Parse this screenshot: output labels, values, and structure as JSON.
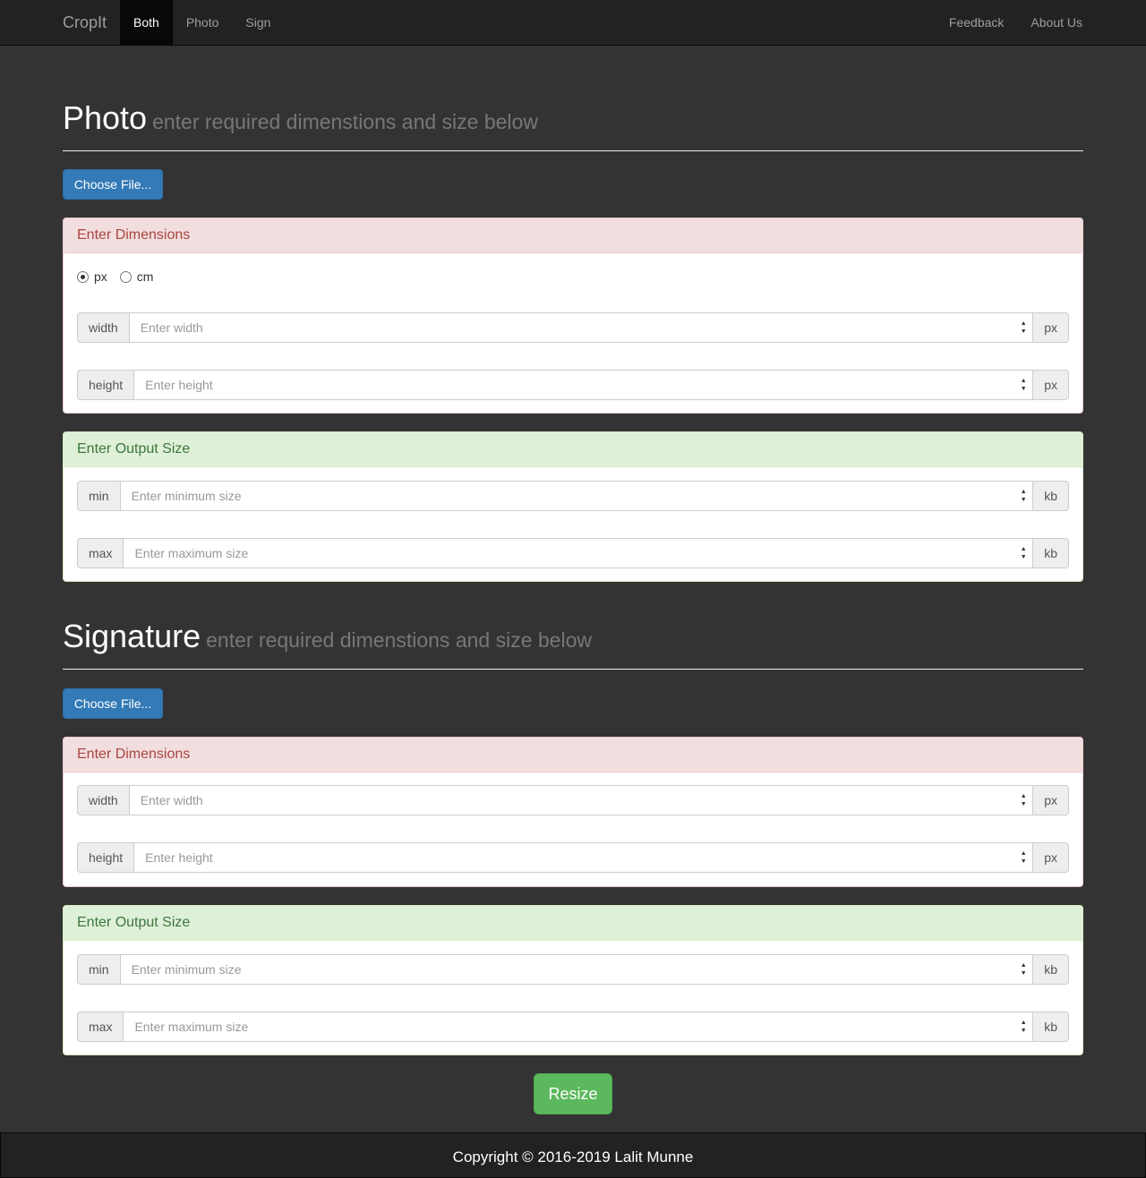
{
  "navbar": {
    "brand": "CropIt",
    "left_items": [
      {
        "label": "Both",
        "active": true
      },
      {
        "label": "Photo",
        "active": false
      },
      {
        "label": "Sign",
        "active": false
      }
    ],
    "right_items": [
      {
        "label": "Feedback"
      },
      {
        "label": "About Us"
      }
    ]
  },
  "photo": {
    "title": "Photo",
    "subtitle": "enter required dimenstions and size below",
    "choose_file_label": "Choose File...",
    "dimensions": {
      "heading": "Enter Dimensions",
      "units": [
        {
          "label": "px",
          "checked": true
        },
        {
          "label": "cm",
          "checked": false
        }
      ],
      "width": {
        "addon": "width",
        "placeholder": "Enter width",
        "unit": "px",
        "value": ""
      },
      "height": {
        "addon": "height",
        "placeholder": "Enter height",
        "unit": "px",
        "value": ""
      }
    },
    "output": {
      "heading": "Enter Output Size",
      "min": {
        "addon": "min",
        "placeholder": "Enter minimum size",
        "unit": "kb",
        "value": ""
      },
      "max": {
        "addon": "max",
        "placeholder": "Enter maximum size",
        "unit": "kb",
        "value": ""
      }
    }
  },
  "signature": {
    "title": "Signature",
    "subtitle": "enter required dimenstions and size below",
    "choose_file_label": "Choose File...",
    "dimensions": {
      "heading": "Enter Dimensions",
      "width": {
        "addon": "width",
        "placeholder": "Enter width",
        "unit": "px",
        "value": ""
      },
      "height": {
        "addon": "height",
        "placeholder": "Enter height",
        "unit": "px",
        "value": ""
      }
    },
    "output": {
      "heading": "Enter Output Size",
      "min": {
        "addon": "min",
        "placeholder": "Enter minimum size",
        "unit": "kb",
        "value": ""
      },
      "max": {
        "addon": "max",
        "placeholder": "Enter maximum size",
        "unit": "kb",
        "value": ""
      }
    }
  },
  "resize_label": "Resize",
  "footer": {
    "text": "Copyright © 2016-2019 Lalit Munne"
  },
  "colors": {
    "navbar_bg": "#222222",
    "page_bg": "#333333",
    "primary": "#337ab7",
    "success": "#5cb85c",
    "danger_heading_bg": "#f2dede",
    "success_heading_bg": "#dff0d8"
  }
}
